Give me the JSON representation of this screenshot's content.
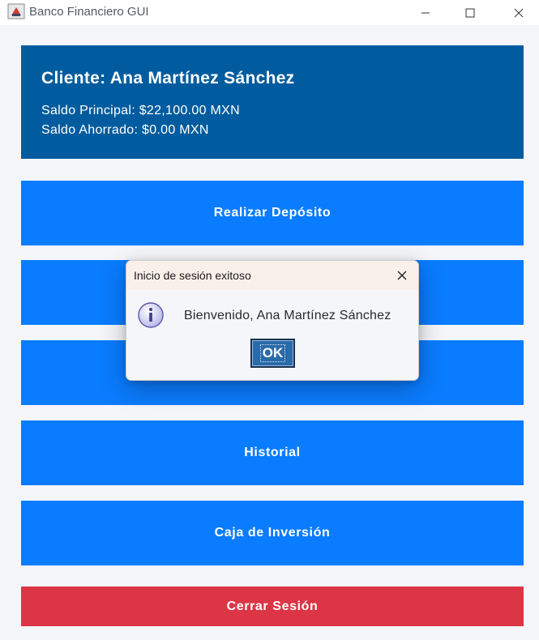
{
  "window": {
    "title": "Banco Financiero GUI",
    "icon": "java-cup-icon",
    "controls": [
      "minimize-icon",
      "maximize-icon",
      "close-icon"
    ]
  },
  "header": {
    "client_name": "Cliente: Ana Martínez Sánchez",
    "main_balance": "Saldo Principal: $22,100.00 MXN",
    "saved_balance": "Saldo Ahorrado: $0.00 MXN"
  },
  "menu": {
    "buttons": [
      {
        "label": "Realizar Depósito"
      },
      {
        "label": ""
      },
      {
        "label": ""
      },
      {
        "label": "Historial"
      },
      {
        "label": "Caja de Inversión"
      }
    ],
    "logout_label": "Cerrar Sesión"
  },
  "dialog": {
    "title": "Inicio de sesión exitoso",
    "message": "Bienvenido, Ana Martínez Sánchez",
    "ok_label": "OK",
    "icon": "info-icon"
  },
  "colors": {
    "header_bg": "#005c9e",
    "button_bg": "#0a7cff",
    "logout_bg": "#dc3545",
    "background": "#f5f6fa"
  }
}
